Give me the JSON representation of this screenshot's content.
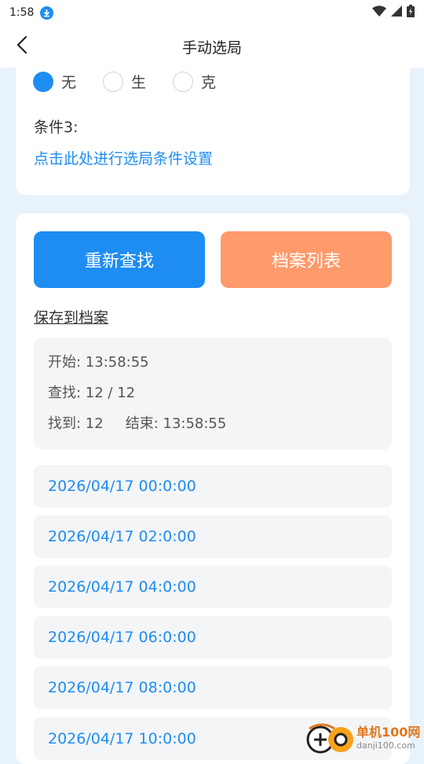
{
  "status_bar": {
    "time": "1:58",
    "icons": [
      "download-icon",
      "wifi-icon",
      "signal-icon",
      "battery-icon"
    ]
  },
  "app_bar": {
    "title": "手动选局",
    "back_icon": "chevron-left-icon"
  },
  "conditions": {
    "radio_options": [
      {
        "label": "无",
        "checked": true
      },
      {
        "label": "生",
        "checked": false
      },
      {
        "label": "克",
        "checked": false
      }
    ],
    "condition3_label": "条件3:",
    "setup_link": "点击此处进行选局条件设置"
  },
  "actions": {
    "search_again": "重新查找",
    "archive_list": "档案列表",
    "save_to_archive": "保存到档案"
  },
  "search_info": {
    "start": "开始: 13:58:55",
    "progress": "查找: 12 / 12",
    "found": "找到: 12",
    "end": "结束: 13:58:55"
  },
  "results": [
    "2026/04/17 00:0:00",
    "2026/04/17 02:0:00",
    "2026/04/17 04:0:00",
    "2026/04/17 06:0:00",
    "2026/04/17 08:0:00",
    "2026/04/17 10:0:00"
  ],
  "watermark": {
    "name": "单机100网",
    "url": "danji100.com"
  },
  "colors": {
    "accent": "#1e8df2",
    "secondary_button": "#ff9a6a",
    "background": "#e8f2fb"
  }
}
